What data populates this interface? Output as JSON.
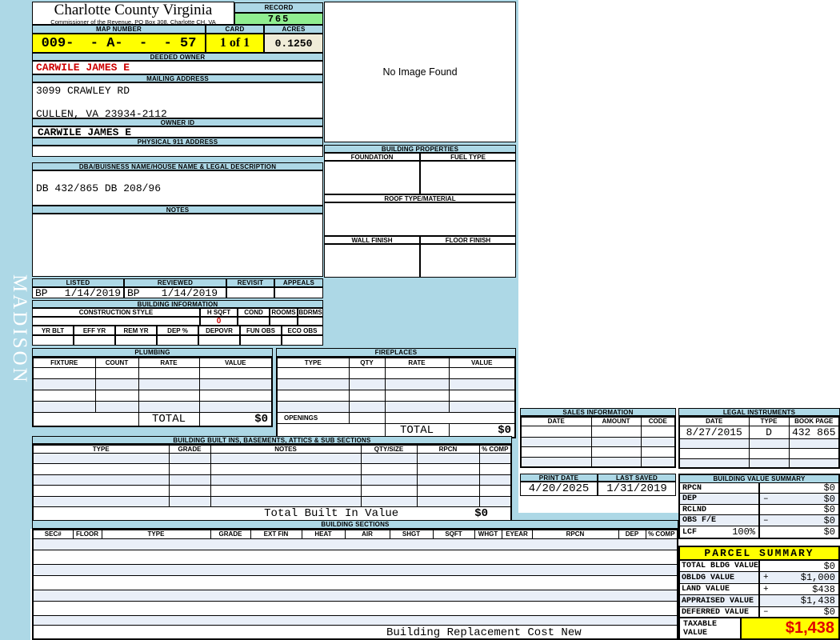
{
  "colors": {
    "accent_lightblue": "#ADD8E6",
    "row_alt_blue": "#E9EFF8",
    "record_green": "#90EE90",
    "highlight_yellow": "#FFFF00",
    "acres_beige": "#F0ECD8",
    "owner_red": "#CC0000",
    "taxable_red": "#E00000"
  },
  "sidebar": {
    "watermark": "MADISON"
  },
  "header": {
    "county_name": "Charlotte County Virginia",
    "office_line": "Commissioner of the Revenue, PO Box 308, Charlotte CH, VA",
    "record_label": "RECORD",
    "record_number": "765",
    "map_number_label": "MAP NUMBER",
    "map_number": "009-  - A-  -  - 57",
    "card_label": "CARD",
    "card": "1 of 1",
    "acres_label": "ACRES",
    "acres": "0.1250"
  },
  "owner": {
    "deeded_owner_label": "DEEDED OWNER",
    "deeded_owner": "CARWILE JAMES E",
    "mailing_address_label": "MAILING ADDRESS",
    "mailing_line1": "3099 CRAWLEY RD",
    "mailing_line2": "CULLEN, VA 23934-2112",
    "owner_id_label": "OWNER ID",
    "owner_id": "CARWILE JAMES E",
    "physical_911_label": "PHYSICAL 911 ADDRESS",
    "dba_legal_label": "DBA/BUISNESS NAME/HOUSE NAME & LEGAL DESCRIPTION",
    "legal_description": "DB 432/865 DB 208/96",
    "notes_label": "NOTES"
  },
  "review": {
    "columns": [
      "LISTED",
      "REVIEWED",
      "REVISIT",
      "APPEALS"
    ],
    "listed_by": "BP",
    "listed_date": "1/14/2019",
    "reviewed_by": "BP",
    "reviewed_date": "1/14/2019"
  },
  "photo": {
    "no_image_text": "No Image Found"
  },
  "building_properties": {
    "title": "BUILDING PROPERTIES",
    "foundation_label": "FOUNDATION",
    "fuel_type_label": "FUEL TYPE",
    "roof_label": "ROOF TYPE/MATERIAL",
    "wall_finish_label": "WALL FINISH",
    "floor_finish_label": "FLOOR FINISH"
  },
  "building_information": {
    "title": "BUILDING INFORMATION",
    "style_columns": [
      "CONSTRUCTION STYLE",
      "H SQFT",
      "COND",
      "ROOMS",
      "BDRMS"
    ],
    "h_sqft": "0",
    "year_columns": [
      "YR BLT",
      "EFF YR",
      "REM YR",
      "DEP %",
      "DEPOVR",
      "FUN OBS",
      "ECO OBS"
    ]
  },
  "plumbing": {
    "title": "PLUMBING",
    "columns": [
      "FIXTURE",
      "COUNT",
      "RATE",
      "VALUE"
    ],
    "total_label": "TOTAL",
    "total": "$0"
  },
  "fireplaces": {
    "title": "FIREPLACES",
    "columns": [
      "TYPE",
      "QTY",
      "RATE",
      "VALUE"
    ],
    "openings_label": "OPENINGS",
    "total_label": "TOTAL",
    "total": "$0"
  },
  "built_ins": {
    "title": "BUILDING BUILT INS, BASEMENTS, ATTICS & SUB SECTIONS",
    "columns": [
      "TYPE",
      "GRADE",
      "NOTES",
      "QTY/SIZE",
      "RPCN",
      "% COMP"
    ],
    "total_label": "Total Built In Value",
    "total": "$0"
  },
  "building_sections": {
    "title": "BUILDING SECTIONS",
    "columns": [
      "SEC#",
      "FLOOR",
      "TYPE",
      "GRADE",
      "EXT FIN",
      "HEAT",
      "AIR",
      "SHGT",
      "SQFT",
      "WHGT",
      "EYEAR",
      "RPCN",
      "DEP",
      "% COMP"
    ],
    "footer_label": "Building Replacement Cost New"
  },
  "sales": {
    "title": "SALES INFORMATION",
    "columns": [
      "DATE",
      "AMOUNT",
      "CODE"
    ]
  },
  "legal_instruments": {
    "title": "LEGAL INSTRUMENTS",
    "columns": [
      "DATE",
      "TYPE",
      "BOOK PAGE"
    ],
    "rows": [
      {
        "date": "8/27/2015",
        "type": "D",
        "book_page": "432 865"
      }
    ]
  },
  "dates": {
    "print_date_label": "PRINT DATE",
    "print_date": "4/20/2025",
    "last_saved_label": "LAST SAVED",
    "last_saved": "1/31/2019"
  },
  "building_value_summary": {
    "title": "BUILDING VALUE SUMMARY",
    "rows": [
      {
        "label": "RPCN",
        "op": "",
        "value": "$0"
      },
      {
        "label": "DEP",
        "op": "–",
        "value": "$0"
      },
      {
        "label": "RCLND",
        "op": "",
        "value": "$0"
      },
      {
        "label": "OBS F/E",
        "op": "–",
        "value": "$0"
      },
      {
        "label": "LCF",
        "pct": "100%",
        "op": "",
        "value": "$0"
      }
    ]
  },
  "parcel_summary": {
    "title": "PARCEL SUMMARY",
    "rows": [
      {
        "label": "TOTAL BLDG VALUE",
        "op": "",
        "value": "$0"
      },
      {
        "label": "OBLDG VALUE",
        "op": "+",
        "value": "$1,000"
      },
      {
        "label": "LAND VALUE",
        "op": "+",
        "value": "$438"
      },
      {
        "label": "APPRAISED VALUE",
        "op": "",
        "value": "$1,438"
      },
      {
        "label": "DEFERRED VALUE",
        "op": "–",
        "value": "$0"
      }
    ],
    "taxable_label": "TAXABLE VALUE",
    "taxable_value": "$1,438"
  }
}
